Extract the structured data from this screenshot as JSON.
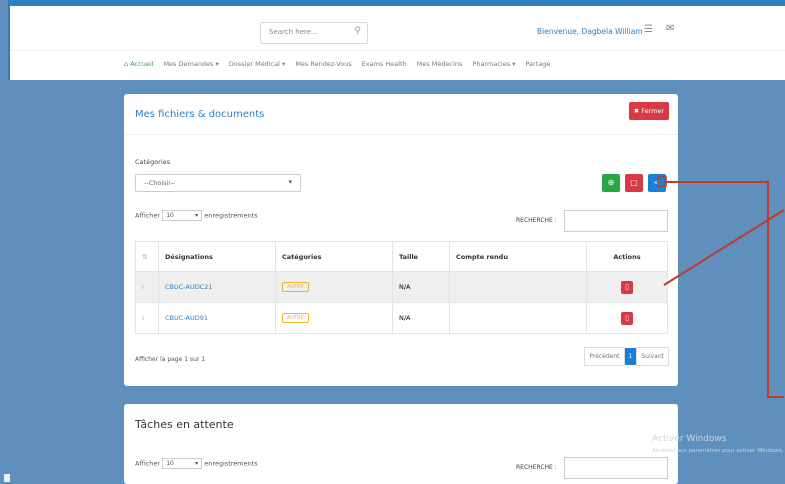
{
  "header": {
    "search_placeholder": "Search here...",
    "welcome": "Bienvenue, Dagbela William"
  },
  "nav": [
    "Accueil",
    "Mes Demandes ▾",
    "Dossier Médical ▾",
    "Mes Rendez-Vous",
    "Exams Health",
    "Mes Médecins",
    "Pharmacies ▾",
    "Partage"
  ],
  "card1": {
    "title": "Mes fichiers & documents",
    "close_label": "✖ Fermer",
    "category_label": "Catégories",
    "category_value": "--Choisir--",
    "show_prefix": "Afficher",
    "show_value": "10",
    "show_suffix": "enregistrements",
    "search_label": "RECHERCHE :",
    "columns": [
      "Désignations",
      "Catégories",
      "Taille",
      "Compte rendu",
      "Actions"
    ],
    "rows": [
      {
        "name": "CBUC-AUDC21",
        "category": "AUTRE",
        "size": "N/A",
        "report": ""
      },
      {
        "name": "CBUC-AUD91",
        "category": "AUTRE",
        "size": "N/A",
        "report": ""
      }
    ],
    "page_info": "Afficher la page 1 sur 1",
    "prev": "Précédent",
    "current_page": "1",
    "next": "Suivant"
  },
  "card2": {
    "title": "Tâches en attente",
    "show_prefix": "Afficher",
    "show_value": "10",
    "show_suffix": "enregistrements",
    "search_label": "RECHERCHE :"
  },
  "overlay": {
    "activate_title": "Activer Windows",
    "activate_sub": "Accédez aux paramètres pour activer Windows."
  },
  "colors": {
    "primary": "#2e7fc2",
    "danger": "#d93845",
    "success": "#28a745",
    "warning": "#f0b429",
    "background": "#5f8fbd"
  }
}
